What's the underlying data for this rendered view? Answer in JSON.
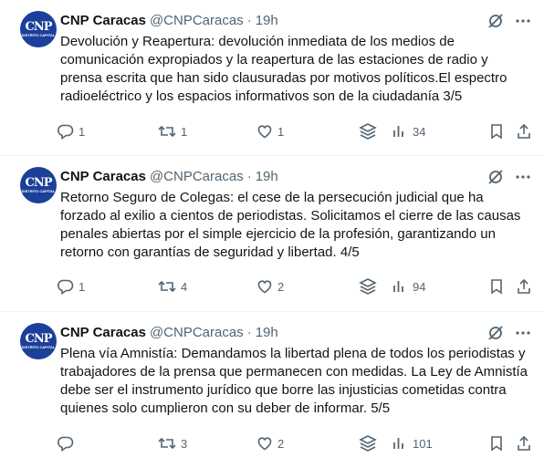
{
  "tweets": [
    {
      "name": "CNP Caracas",
      "handle": "@CNPCaracas",
      "separator": "·",
      "time": "19h",
      "avatar": {
        "mark": "CNP",
        "sub": "DISTRITO CAPITAL"
      },
      "text": "Devolución y Reapertura:  devolución inmediata de los medios de comunicación expropiados y la reapertura de las estaciones de radio y prensa escrita que han sido clausuradas por motivos políticos.El espectro radioeléctrico y los espacios informativos son de la ciudadanía 3/5",
      "replies": "1",
      "reposts": "1",
      "likes": "1",
      "views": "34"
    },
    {
      "name": "CNP Caracas",
      "handle": "@CNPCaracas",
      "separator": "·",
      "time": "19h",
      "avatar": {
        "mark": "CNP",
        "sub": "DISTRITO CAPITAL"
      },
      "text": "Retorno Seguro de Colegas:  el cese de la persecución judicial que ha forzado al exilio a cientos de periodistas. Solicitamos el cierre de las causas penales abiertas por el simple ejercicio de la profesión, garantizando un retorno con garantías de seguridad y libertad. 4/5",
      "replies": "1",
      "reposts": "4",
      "likes": "2",
      "views": "94"
    },
    {
      "name": "CNP Caracas",
      "handle": "@CNPCaracas",
      "separator": "·",
      "time": "19h",
      "avatar": {
        "mark": "CNP",
        "sub": "DISTRITO CAPITAL"
      },
      "text": "Plena vía Amnistía: Demandamos la libertad plena de todos los periodistas y trabajadores de la prensa que permanecen con medidas. La Ley de Amnistía debe ser el instrumento jurídico que borre las injusticias cometidas contra quienes solo cumplieron con su deber de informar. 5/5",
      "replies": "",
      "reposts": "3",
      "likes": "2",
      "views": "101"
    }
  ],
  "icons": {
    "grok": "grok-icon",
    "more": "more-icon",
    "reply": "reply-icon",
    "repost": "repost-icon",
    "like": "like-icon",
    "stack": "layers-icon",
    "views": "views-icon",
    "bookmark": "bookmark-icon",
    "share": "share-icon"
  },
  "colors": {
    "secondary": "#536471",
    "avatar": "#1c3f99",
    "divider": "#eff3f4"
  }
}
